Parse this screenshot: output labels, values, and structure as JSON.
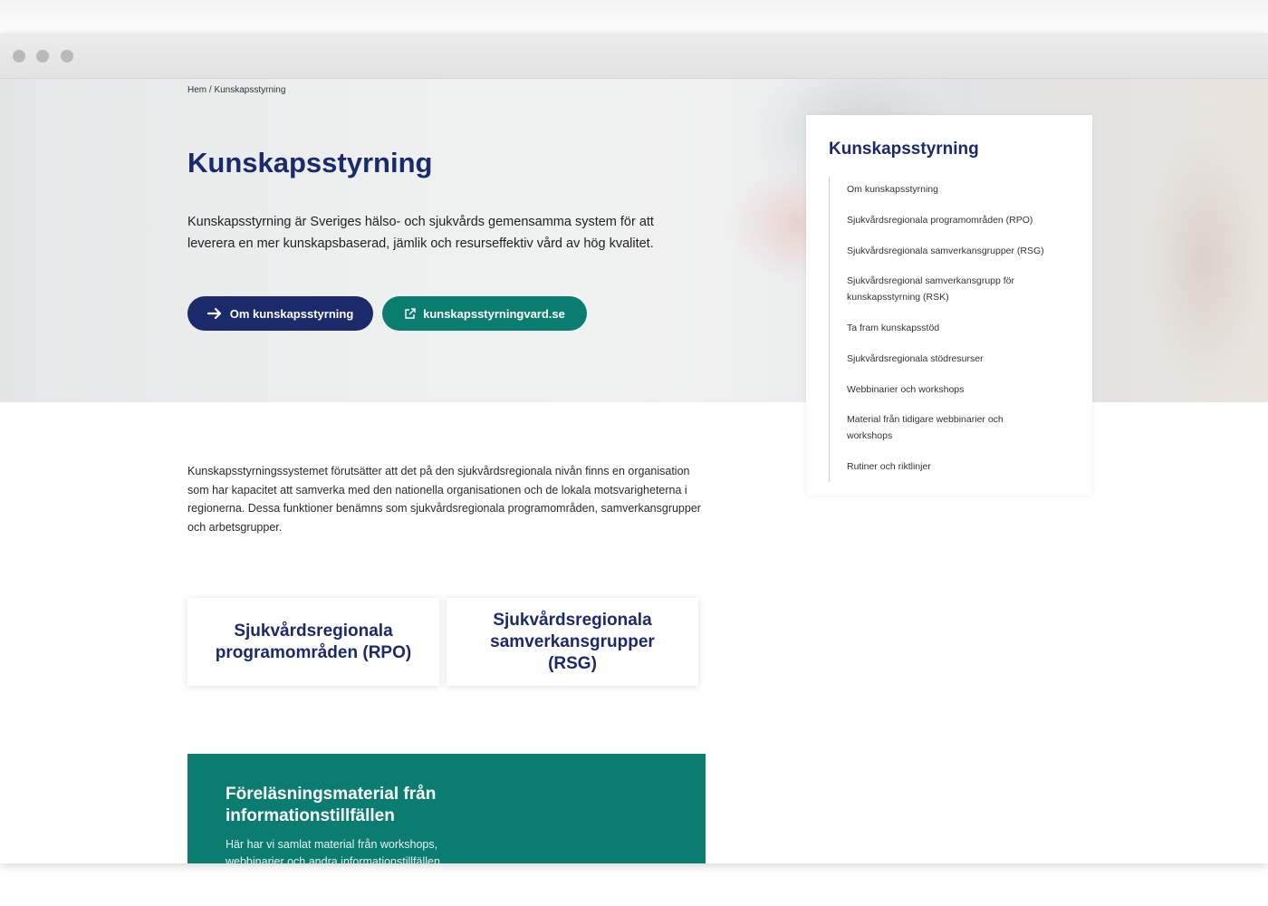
{
  "breadcrumb": "Hem / Kunskapsstyrning",
  "hero": {
    "title": "Kunskapsstyrning",
    "lead": "Kunskapsstyrning är Sveriges hälso- och sjukvårds gemensamma system för att leverera en mer kunskapsbaserad, jämlik och resurseffektiv vård av hög kvalitet.",
    "primary_button": "Om kunskapsstyrning",
    "secondary_button": "kunskapsstyrningvard.se"
  },
  "sidenav": {
    "title": "Kunskapsstyrning",
    "items": [
      "Om kunskapsstyrning",
      "Sjukvårdsregionala programområden (RPO)",
      "Sjukvårdsregionala samverkansgrupper (RSG)",
      "Sjukvårdsregional samverkansgrupp för kunskapsstyrning (RSK)",
      "Ta fram kunskapsstöd",
      "Sjukvårdsregionala stödresurser",
      "Webbinarier och workshops",
      "Material från tidigare webbinarier och workshops",
      "Rutiner och riktlinjer"
    ]
  },
  "body_text": "Kunskapsstyrningssystemet förutsätter att det  på den sjukvårdsregionala nivån finns en organisation som har kapacitet att samverka med den nationella organisationen och de lokala motsvarigheterna i regionerna. Dessa funktioner benämns som sjukvårdsregionala programområden, samverkansgrupper och arbetsgrupper.",
  "cards": {
    "rpo": "Sjukvårdsregionala programområden (RPO)",
    "rsg": "Sjukvårdsregionala samverkansgrupper (RSG)"
  },
  "promo": {
    "title": "Föreläsningsmaterial från informationstillfällen",
    "text": "Här har vi samlat material från workshops, webbinarier och andra informationstillfällen."
  },
  "colors": {
    "navy": "#1b2a6b",
    "teal": "#0b7d70"
  }
}
